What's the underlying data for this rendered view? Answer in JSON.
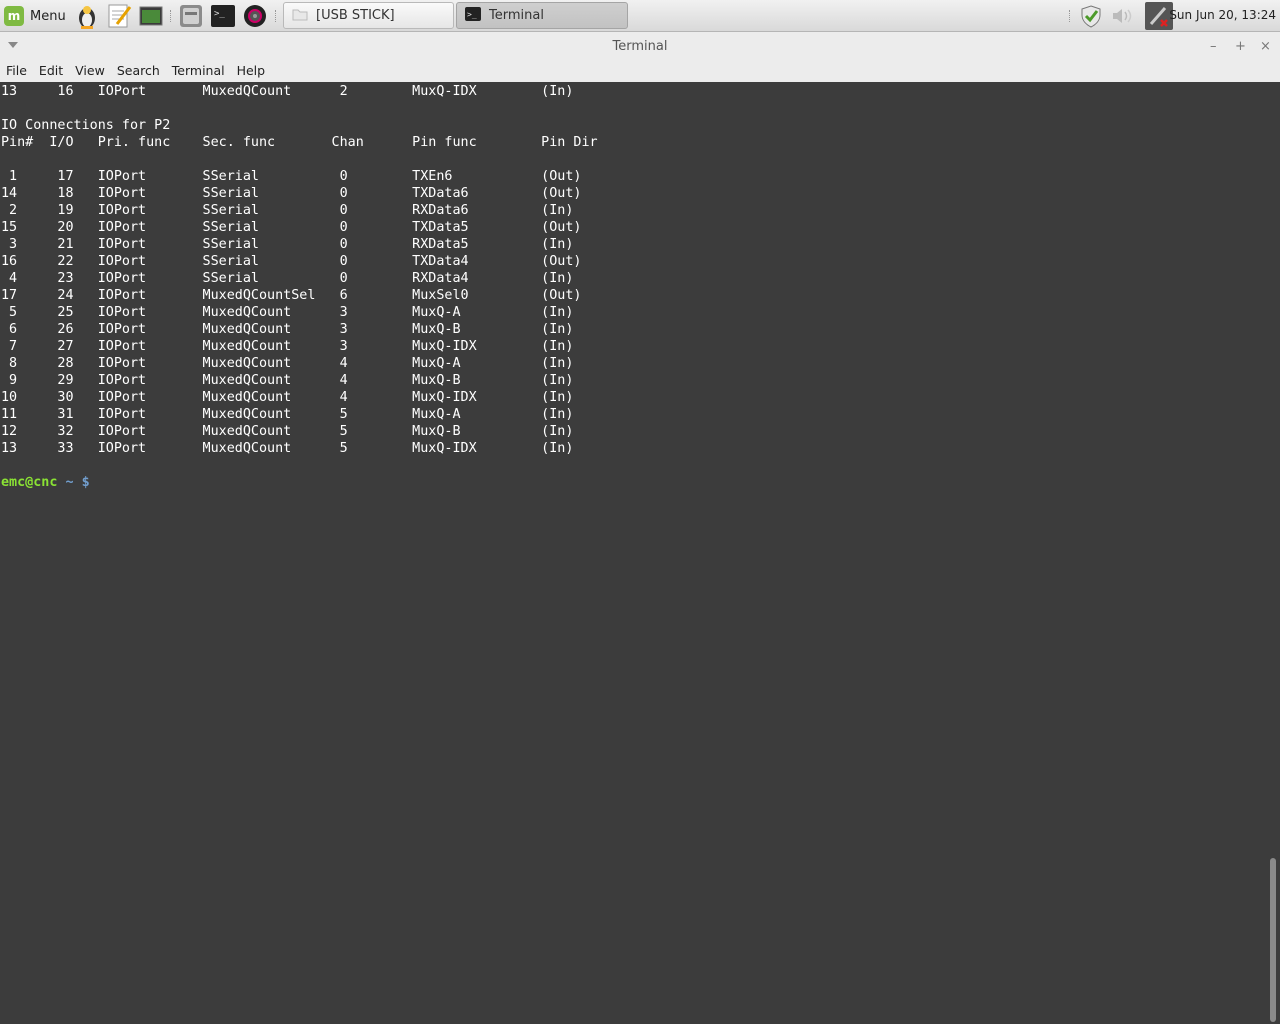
{
  "panel": {
    "menu_label": "Menu",
    "mint_logo": "m",
    "launchers": [
      "mintupdate-icon",
      "text-editor-icon",
      "desktop-icon",
      "disk-icon",
      "terminal-launcher-icon",
      "camera-icon"
    ],
    "tasks": [
      {
        "label": "[USB STICK]",
        "icon": "folder-icon"
      },
      {
        "label": "Terminal",
        "icon": "terminal-icon"
      }
    ],
    "clock": "Sun Jun 20, 13:24"
  },
  "window": {
    "title": "Terminal",
    "minimize": "–",
    "maximize": "+",
    "close": "×"
  },
  "menubar": [
    "File",
    "Edit",
    "View",
    "Search",
    "Terminal",
    "Help"
  ],
  "terminal": {
    "lines": [
      "13     16   IOPort       MuxedQCount      2        MuxQ-IDX        (In)",
      "",
      "IO Connections for P2",
      "Pin#  I/O   Pri. func    Sec. func       Chan      Pin func        Pin Dir",
      "",
      " 1     17   IOPort       SSerial          0        TXEn6           (Out)",
      "14     18   IOPort       SSerial          0        TXData6         (Out)",
      " 2     19   IOPort       SSerial          0        RXData6         (In)",
      "15     20   IOPort       SSerial          0        TXData5         (Out)",
      " 3     21   IOPort       SSerial          0        RXData5         (In)",
      "16     22   IOPort       SSerial          0        TXData4         (Out)",
      " 4     23   IOPort       SSerial          0        RXData4         (In)",
      "17     24   IOPort       MuxedQCountSel   6        MuxSel0         (Out)",
      " 5     25   IOPort       MuxedQCount      3        MuxQ-A          (In)",
      " 6     26   IOPort       MuxedQCount      3        MuxQ-B          (In)",
      " 7     27   IOPort       MuxedQCount      3        MuxQ-IDX        (In)",
      " 8     28   IOPort       MuxedQCount      4        MuxQ-A          (In)",
      " 9     29   IOPort       MuxedQCount      4        MuxQ-B          (In)",
      "10     30   IOPort       MuxedQCount      4        MuxQ-IDX        (In)",
      "11     31   IOPort       MuxedQCount      5        MuxQ-A          (In)",
      "12     32   IOPort       MuxedQCount      5        MuxQ-B          (In)",
      "13     33   IOPort       MuxedQCount      5        MuxQ-IDX        (In)",
      ""
    ],
    "prompt_user": "emc@cnc",
    "prompt_path": " ~ $",
    "colors": {
      "background": "#3c3c3c",
      "text": "#ffffff",
      "prompt_user": "#8ae234",
      "prompt_path": "#729fcf"
    }
  }
}
